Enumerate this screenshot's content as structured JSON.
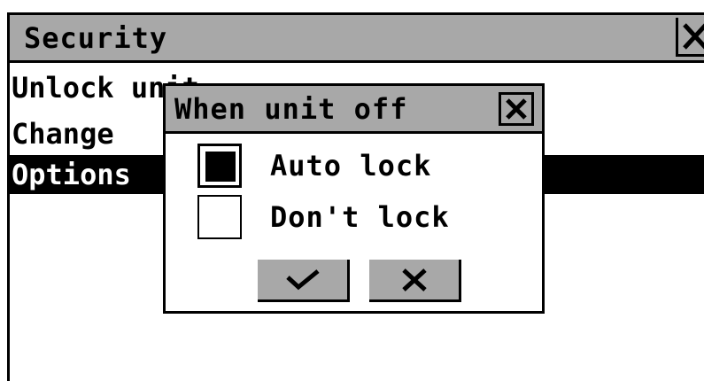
{
  "window": {
    "title": "Security"
  },
  "menu": {
    "items": [
      {
        "label": "Unlock unit",
        "selected": false
      },
      {
        "label": "Change",
        "selected": false
      },
      {
        "label": "Options",
        "selected": true
      }
    ]
  },
  "dialog": {
    "title": "When unit off",
    "options": [
      {
        "label": "Auto lock",
        "checked": true
      },
      {
        "label": "Don't lock",
        "checked": false
      }
    ],
    "buttons": {
      "ok_icon": "check-icon",
      "cancel_icon": "x-icon"
    }
  },
  "colors": {
    "titlebar": "#a8a8a8",
    "selection": "#000000",
    "background": "#ffffff"
  }
}
